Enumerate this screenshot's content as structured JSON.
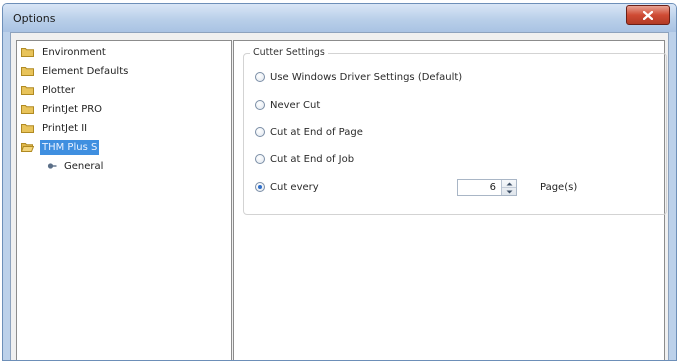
{
  "window": {
    "title": "Options",
    "close_icon": "close-icon",
    "title_bar_color": "#bcd1ea",
    "close_color": "#cf4b34"
  },
  "tree": {
    "items": [
      {
        "label": "Environment",
        "icon": "folder-icon",
        "selected": false
      },
      {
        "label": "Element Defaults",
        "icon": "folder-icon",
        "selected": false
      },
      {
        "label": "Plotter",
        "icon": "folder-icon",
        "selected": false
      },
      {
        "label": "PrintJet PRO",
        "icon": "folder-icon",
        "selected": false
      },
      {
        "label": "PrintJet II",
        "icon": "folder-icon",
        "selected": false
      },
      {
        "label": "THM Plus S",
        "icon": "folder-open-icon",
        "selected": true
      }
    ],
    "child": {
      "label": "General",
      "icon": "bullet-icon"
    },
    "selection_color": "#3f8fe0"
  },
  "cutter": {
    "group_label": "Cutter Settings",
    "options": [
      {
        "label": "Use Windows Driver Settings (Default)",
        "checked": false
      },
      {
        "label": "Never Cut",
        "checked": false
      },
      {
        "label": "Cut at End of Page",
        "checked": false
      },
      {
        "label": "Cut at End of Job",
        "checked": false
      },
      {
        "label": "Cut every",
        "checked": true
      }
    ],
    "every_value": "6",
    "every_unit": "Page(s)"
  }
}
